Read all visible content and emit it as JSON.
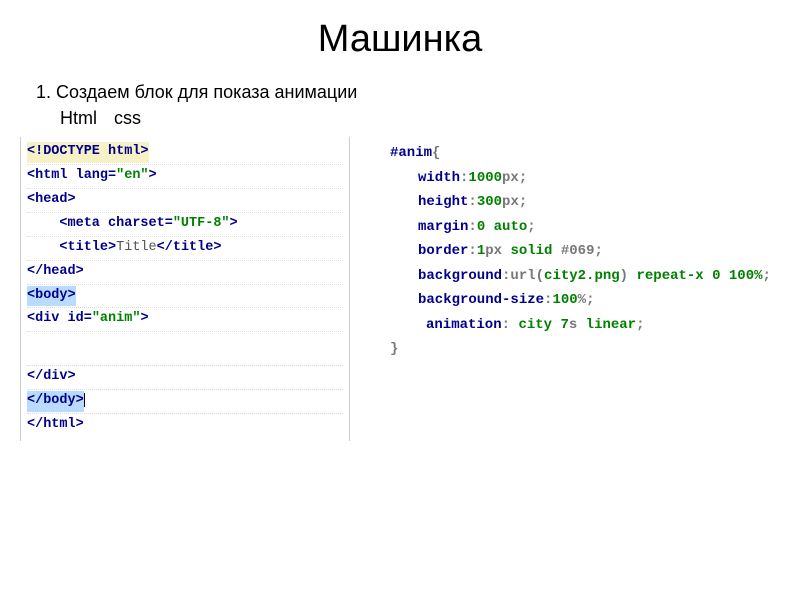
{
  "title": "Машинка",
  "step": "1. Создаем блок для показа анимации",
  "labels": {
    "left": "Html",
    "right": "css"
  },
  "html_lines": {
    "l1": "<!DOCTYPE html>",
    "l2_open": "<html ",
    "l2_attr": "lang=",
    "l2_val": "\"en\"",
    "l2_close": ">",
    "l3": "<head>",
    "l4_tag": "<meta ",
    "l4_attr": "charset=",
    "l4_val": "\"UTF-8\"",
    "l4_close": ">",
    "l5_open": "<title>",
    "l5_text": "Title",
    "l5_close": "</title>",
    "l6": "</head>",
    "l7": "<body>",
    "l8_open": "<div ",
    "l8_attr": "id=",
    "l8_val": "\"anim\"",
    "l8_close": ">",
    "l9": "</div>",
    "l10": "</body>",
    "l11": "</html>"
  },
  "css": {
    "selector": "#anim",
    "brace_open": "{",
    "brace_close": "}",
    "p1": {
      "prop": "width",
      "val": "1000",
      "unit": "px",
      "end": ";"
    },
    "p2": {
      "prop": "height",
      "val": "300",
      "unit": "px",
      "end": ";"
    },
    "p3": {
      "prop": "margin",
      "val1": "0",
      "val2": "auto",
      "end": ";"
    },
    "p4": {
      "prop": "border",
      "val1": "1",
      "unit1": "px",
      "val2": "solid",
      "color": "#069",
      "end": ";"
    },
    "p5": {
      "prop": "background",
      "fn": "url",
      "arg": "city2.png",
      "rest": "repeat-x 0 100%",
      "end": ";"
    },
    "p6": {
      "prop": "background-size",
      "val": "100",
      "unit": "%",
      "end": ";"
    },
    "p7": {
      "prop": "animation",
      "name": "city",
      "dur": "7",
      "durunit": "s",
      "timing": "linear",
      "end": ";"
    }
  }
}
